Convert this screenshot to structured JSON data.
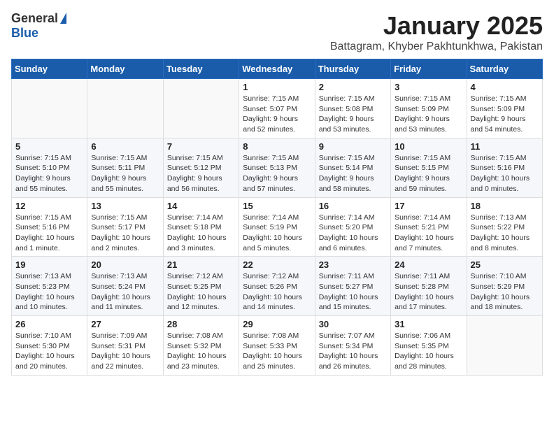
{
  "header": {
    "logo_general": "General",
    "logo_blue": "Blue",
    "title_month": "January 2025",
    "title_location": "Battagram, Khyber Pakhtunkhwa, Pakistan"
  },
  "calendar": {
    "days_of_week": [
      "Sunday",
      "Monday",
      "Tuesday",
      "Wednesday",
      "Thursday",
      "Friday",
      "Saturday"
    ],
    "weeks": [
      {
        "cells": [
          {
            "day": "",
            "info": ""
          },
          {
            "day": "",
            "info": ""
          },
          {
            "day": "",
            "info": ""
          },
          {
            "day": "1",
            "info": "Sunrise: 7:15 AM\nSunset: 5:07 PM\nDaylight: 9 hours and 52 minutes."
          },
          {
            "day": "2",
            "info": "Sunrise: 7:15 AM\nSunset: 5:08 PM\nDaylight: 9 hours and 53 minutes."
          },
          {
            "day": "3",
            "info": "Sunrise: 7:15 AM\nSunset: 5:09 PM\nDaylight: 9 hours and 53 minutes."
          },
          {
            "day": "4",
            "info": "Sunrise: 7:15 AM\nSunset: 5:09 PM\nDaylight: 9 hours and 54 minutes."
          }
        ]
      },
      {
        "cells": [
          {
            "day": "5",
            "info": "Sunrise: 7:15 AM\nSunset: 5:10 PM\nDaylight: 9 hours and 55 minutes."
          },
          {
            "day": "6",
            "info": "Sunrise: 7:15 AM\nSunset: 5:11 PM\nDaylight: 9 hours and 55 minutes."
          },
          {
            "day": "7",
            "info": "Sunrise: 7:15 AM\nSunset: 5:12 PM\nDaylight: 9 hours and 56 minutes."
          },
          {
            "day": "8",
            "info": "Sunrise: 7:15 AM\nSunset: 5:13 PM\nDaylight: 9 hours and 57 minutes."
          },
          {
            "day": "9",
            "info": "Sunrise: 7:15 AM\nSunset: 5:14 PM\nDaylight: 9 hours and 58 minutes."
          },
          {
            "day": "10",
            "info": "Sunrise: 7:15 AM\nSunset: 5:15 PM\nDaylight: 9 hours and 59 minutes."
          },
          {
            "day": "11",
            "info": "Sunrise: 7:15 AM\nSunset: 5:16 PM\nDaylight: 10 hours and 0 minutes."
          }
        ]
      },
      {
        "cells": [
          {
            "day": "12",
            "info": "Sunrise: 7:15 AM\nSunset: 5:16 PM\nDaylight: 10 hours and 1 minute."
          },
          {
            "day": "13",
            "info": "Sunrise: 7:15 AM\nSunset: 5:17 PM\nDaylight: 10 hours and 2 minutes."
          },
          {
            "day": "14",
            "info": "Sunrise: 7:14 AM\nSunset: 5:18 PM\nDaylight: 10 hours and 3 minutes."
          },
          {
            "day": "15",
            "info": "Sunrise: 7:14 AM\nSunset: 5:19 PM\nDaylight: 10 hours and 5 minutes."
          },
          {
            "day": "16",
            "info": "Sunrise: 7:14 AM\nSunset: 5:20 PM\nDaylight: 10 hours and 6 minutes."
          },
          {
            "day": "17",
            "info": "Sunrise: 7:14 AM\nSunset: 5:21 PM\nDaylight: 10 hours and 7 minutes."
          },
          {
            "day": "18",
            "info": "Sunrise: 7:13 AM\nSunset: 5:22 PM\nDaylight: 10 hours and 8 minutes."
          }
        ]
      },
      {
        "cells": [
          {
            "day": "19",
            "info": "Sunrise: 7:13 AM\nSunset: 5:23 PM\nDaylight: 10 hours and 10 minutes."
          },
          {
            "day": "20",
            "info": "Sunrise: 7:13 AM\nSunset: 5:24 PM\nDaylight: 10 hours and 11 minutes."
          },
          {
            "day": "21",
            "info": "Sunrise: 7:12 AM\nSunset: 5:25 PM\nDaylight: 10 hours and 12 minutes."
          },
          {
            "day": "22",
            "info": "Sunrise: 7:12 AM\nSunset: 5:26 PM\nDaylight: 10 hours and 14 minutes."
          },
          {
            "day": "23",
            "info": "Sunrise: 7:11 AM\nSunset: 5:27 PM\nDaylight: 10 hours and 15 minutes."
          },
          {
            "day": "24",
            "info": "Sunrise: 7:11 AM\nSunset: 5:28 PM\nDaylight: 10 hours and 17 minutes."
          },
          {
            "day": "25",
            "info": "Sunrise: 7:10 AM\nSunset: 5:29 PM\nDaylight: 10 hours and 18 minutes."
          }
        ]
      },
      {
        "cells": [
          {
            "day": "26",
            "info": "Sunrise: 7:10 AM\nSunset: 5:30 PM\nDaylight: 10 hours and 20 minutes."
          },
          {
            "day": "27",
            "info": "Sunrise: 7:09 AM\nSunset: 5:31 PM\nDaylight: 10 hours and 22 minutes."
          },
          {
            "day": "28",
            "info": "Sunrise: 7:08 AM\nSunset: 5:32 PM\nDaylight: 10 hours and 23 minutes."
          },
          {
            "day": "29",
            "info": "Sunrise: 7:08 AM\nSunset: 5:33 PM\nDaylight: 10 hours and 25 minutes."
          },
          {
            "day": "30",
            "info": "Sunrise: 7:07 AM\nSunset: 5:34 PM\nDaylight: 10 hours and 26 minutes."
          },
          {
            "day": "31",
            "info": "Sunrise: 7:06 AM\nSunset: 5:35 PM\nDaylight: 10 hours and 28 minutes."
          },
          {
            "day": "",
            "info": ""
          }
        ]
      }
    ]
  }
}
